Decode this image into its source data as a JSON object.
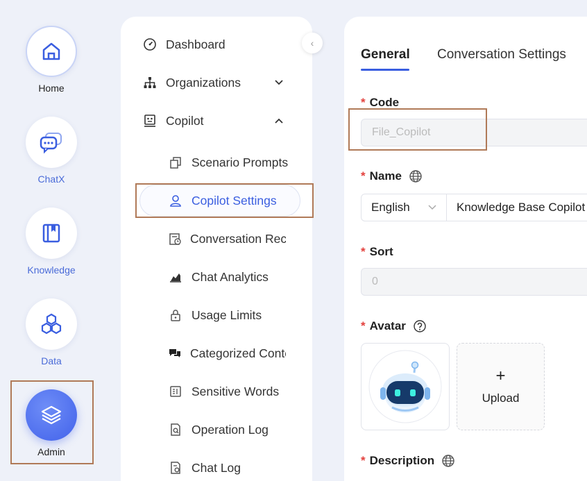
{
  "rail": {
    "items": [
      {
        "label": "Home",
        "icon": "home-icon"
      },
      {
        "label": "ChatX",
        "icon": "chat-icon"
      },
      {
        "label": "Knowledge",
        "icon": "book-icon"
      },
      {
        "label": "Data",
        "icon": "hexagons-icon"
      },
      {
        "label": "Admin",
        "icon": "layers-icon"
      }
    ]
  },
  "sidebar": {
    "items": [
      {
        "label": "Dashboard"
      },
      {
        "label": "Organizations"
      },
      {
        "label": "Copilot"
      },
      {
        "label": "Scenario Prompts"
      },
      {
        "label": "Copilot Settings"
      },
      {
        "label": "Conversation Reco"
      },
      {
        "label": "Chat Analytics"
      },
      {
        "label": "Usage Limits"
      },
      {
        "label": "Categorized Conte"
      },
      {
        "label": "Sensitive Words"
      },
      {
        "label": "Operation Log"
      },
      {
        "label": "Chat Log"
      }
    ]
  },
  "main": {
    "tabs": [
      {
        "label": "General"
      },
      {
        "label": "Conversation Settings"
      }
    ],
    "form": {
      "code": {
        "label": "Code",
        "value": "File_Copilot"
      },
      "name": {
        "label": "Name",
        "language": "English",
        "value": "Knowledge Base Copilot"
      },
      "sort": {
        "label": "Sort",
        "value": "0"
      },
      "avatar": {
        "label": "Avatar",
        "upload_label": "Upload",
        "plus": "+"
      },
      "description": {
        "label": "Description"
      },
      "required_mark": "*"
    }
  },
  "colors": {
    "accent": "#3a5ee0",
    "required": "#e3413d",
    "highlight_box": "#b07a58"
  }
}
